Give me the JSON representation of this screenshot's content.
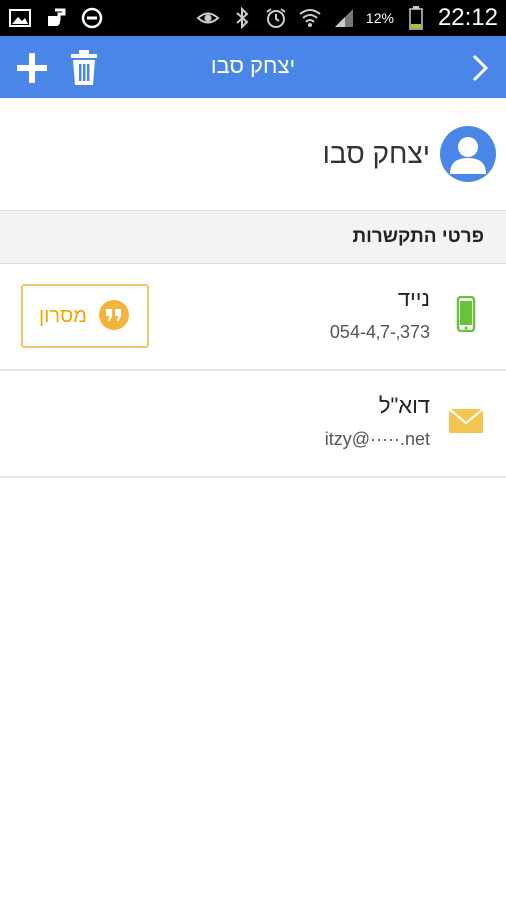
{
  "status_bar": {
    "battery_percent": "12%",
    "time": "22:12",
    "icons": [
      "gallery-icon",
      "music-icon",
      "do-not-disturb-icon",
      "eye-icon",
      "bluetooth-icon",
      "alarm-icon",
      "wifi-icon",
      "signal-icon",
      "battery-icon"
    ]
  },
  "app_bar": {
    "title": "יצחק סבו",
    "add_icon": "plus-icon",
    "delete_icon": "trash-icon",
    "back_icon": "chevron-right-icon",
    "color": "#4a86e8"
  },
  "contact": {
    "name": "יצחק סבו",
    "avatar_icon": "person-icon"
  },
  "section": {
    "title": "פרטי התקשרות"
  },
  "rows": [
    {
      "label": "נייד",
      "value": "054-4‚7-‚373",
      "icon": "mobile-phone-icon",
      "action_label": "מסרון",
      "action_icon": "chat-quote-icon"
    },
    {
      "label": "דוא\"ל",
      "value": "itzy@·····.net",
      "icon": "envelope-icon"
    }
  ],
  "colors": {
    "accent": "#4a86e8",
    "message": "#f0a500",
    "phone_icon": "#6ac13b",
    "mail_icon": "#f3c553"
  }
}
